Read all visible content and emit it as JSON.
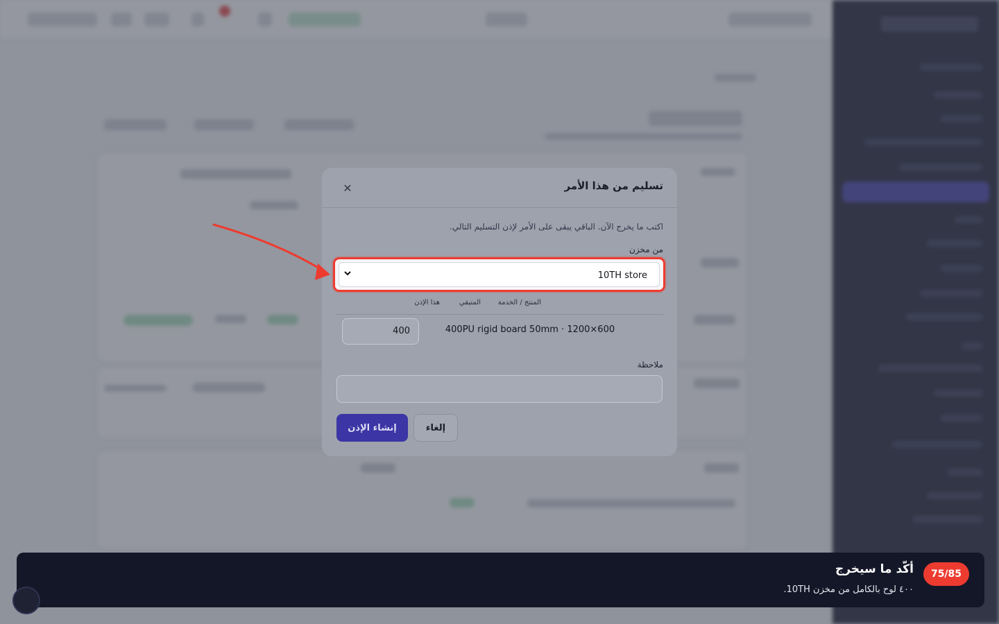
{
  "modal": {
    "title": "تسليم من هذا الأمر",
    "close_icon": "close-icon",
    "helper_text": "اكتب ما يخرج الآن. الباقي يبقى على الأمر لإذن التسليم التالي.",
    "store_label": "من مخزن",
    "store_select": {
      "value": "10TH store",
      "icon": "chevron-down-icon"
    },
    "table": {
      "headers": [
        "المنتج / الخدمة",
        "المتبقي",
        "هذا الإذن"
      ],
      "rows": [
        {
          "product": "400PU rigid board 50mm · 1200×600",
          "remaining": "",
          "quantity": "400"
        }
      ]
    },
    "note_label": "ملاحظة",
    "note_value": "",
    "buttons": {
      "create": "إنشاء الإذن",
      "cancel": "إلغاء"
    }
  },
  "tour": {
    "step": "75/85",
    "title": "أكّد ما سيخرج",
    "subtitle": "٤٠٠ لوح بالكامل من مخزن 10TH."
  },
  "colors": {
    "highlight": "#ee3b30",
    "primary": "#3b35a5",
    "banner_bg": "#141727",
    "sidebar_bg": "#161a2e"
  }
}
